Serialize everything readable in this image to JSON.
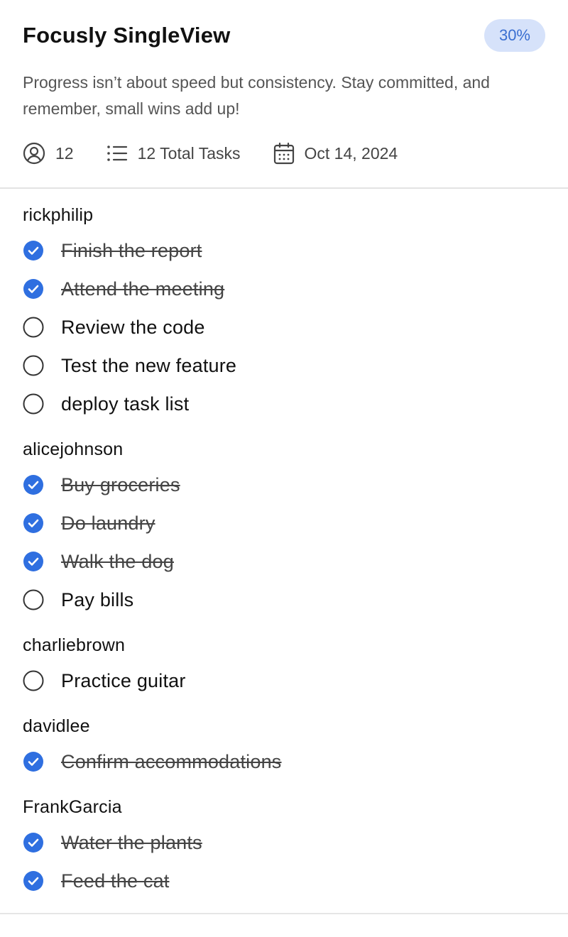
{
  "app": {
    "title": "Focusly SingleView",
    "progress_badge": "30%",
    "subtitle": "Progress isn’t about speed but consistency. Stay committed, and remember, small wins add up!",
    "meta": {
      "members": "12",
      "members_icon": "user-circle-icon",
      "tasks": "12 Total Tasks",
      "tasks_icon": "list-icon",
      "date": "Oct 14, 2024",
      "date_icon": "calendar-icon"
    }
  },
  "colors": {
    "accent": "#2f6fe0",
    "badge_bg": "#d6e2fa",
    "badge_text": "#3a6fd1"
  },
  "groups": [
    {
      "name": "rickphilip",
      "tasks": [
        {
          "label": "Finish the report",
          "done": true
        },
        {
          "label": "Attend the meeting",
          "done": true
        },
        {
          "label": "Review the code",
          "done": false
        },
        {
          "label": "Test the new feature",
          "done": false
        },
        {
          "label": "deploy task list",
          "done": false
        }
      ]
    },
    {
      "name": "alicejohnson",
      "tasks": [
        {
          "label": "Buy groceries",
          "done": true
        },
        {
          "label": "Do laundry",
          "done": true
        },
        {
          "label": "Walk the dog",
          "done": true
        },
        {
          "label": "Pay bills",
          "done": false
        }
      ]
    },
    {
      "name": "charliebrown",
      "tasks": [
        {
          "label": "Practice guitar",
          "done": false
        }
      ]
    },
    {
      "name": "davidlee",
      "tasks": [
        {
          "label": "Confirm accommodations",
          "done": true
        }
      ]
    },
    {
      "name": "FrankGarcia",
      "tasks": [
        {
          "label": "Water the plants",
          "done": true
        },
        {
          "label": "Feed the cat",
          "done": true
        }
      ]
    }
  ]
}
